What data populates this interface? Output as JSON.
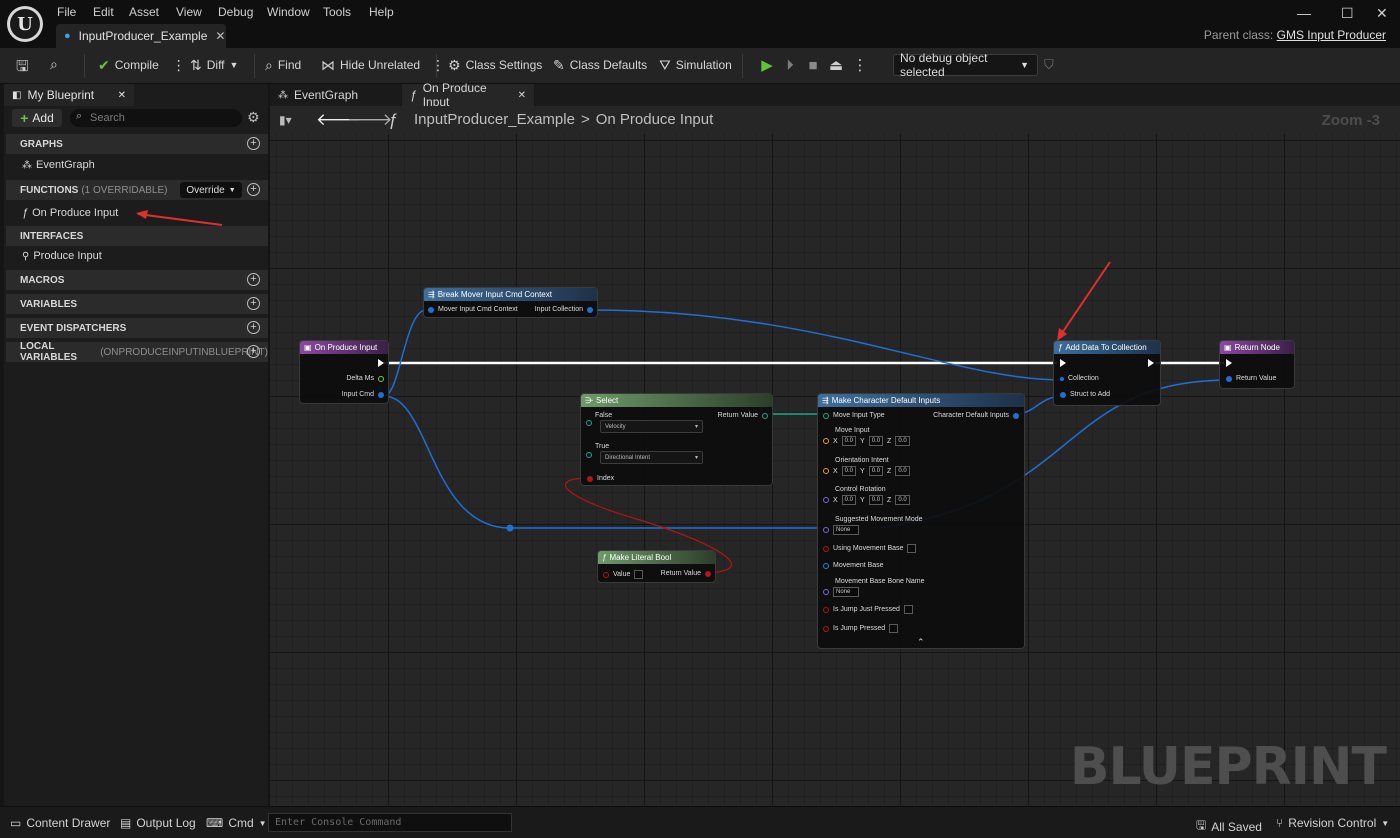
{
  "menu": [
    "File",
    "Edit",
    "Asset",
    "View",
    "Debug",
    "Window",
    "Tools",
    "Help"
  ],
  "document_tab": "InputProducer_Example",
  "parent_class": {
    "label": "Parent class:",
    "value": "GMS Input Producer"
  },
  "toolbar": {
    "compile": "Compile",
    "diff": "Diff",
    "find": "Find",
    "hide_unrelated": "Hide Unrelated",
    "class_settings": "Class Settings",
    "class_defaults": "Class Defaults",
    "simulation": "Simulation",
    "debug_object": "No debug object selected"
  },
  "left_panel": {
    "tab": "My Blueprint",
    "add": "Add",
    "search_placeholder": "Search",
    "sections": {
      "graphs": "GRAPHS",
      "functions": "FUNCTIONS",
      "functions_sub": "(1 OVERRIDABLE)",
      "override": "Override",
      "interfaces": "INTERFACES",
      "macros": "MACROS",
      "variables": "VARIABLES",
      "event_dispatchers": "EVENT DISPATCHERS",
      "local_variables": "LOCAL VARIABLES",
      "local_variables_sub": "(ONPRODUCEINPUTINBLUEPRINT)"
    },
    "items": {
      "event_graph": "EventGraph",
      "on_produce_input": "On Produce Input",
      "produce_input": "Produce Input"
    }
  },
  "graph_tabs": [
    "EventGraph",
    "On Produce Input"
  ],
  "breadcrumb": {
    "root": "InputProducer_Example",
    "sep": ">",
    "current": "On Produce Input"
  },
  "zoom": "Zoom -3",
  "watermark": "BLUEPRINT",
  "nodes": {
    "on_produce_input": {
      "title": "On Produce Input",
      "pins": [
        "Delta Ms",
        "Input Cmd"
      ]
    },
    "break_context": {
      "title": "Break Mover Input Cmd Context",
      "pins": [
        "Mover Input Cmd Context",
        "Input Collection"
      ]
    },
    "select": {
      "title": "Select",
      "false_label": "False",
      "false_value": "Velocity",
      "true_label": "True",
      "true_value": "Directional Intent",
      "index": "Index",
      "return": "Return Value"
    },
    "make_literal_bool": {
      "title": "Make Literal Bool",
      "value": "Value",
      "return": "Return Value"
    },
    "make_defaults": {
      "title": "Make Character Default Inputs",
      "out": "Character Default Inputs",
      "move_input_type": "Move Input Type",
      "move_input": "Move Input",
      "orientation_intent": "Orientation Intent",
      "control_rotation": "Control Rotation",
      "suggested_mode": "Suggested Movement Mode",
      "none": "None",
      "using_base": "Using Movement Base",
      "movement_base": "Movement Base",
      "base_bone": "Movement Base Bone Name",
      "jump_just": "Is Jump Just Pressed",
      "jump": "Is Jump Pressed",
      "x": "X",
      "y": "Y",
      "z": "Z",
      "zero": "0.0"
    },
    "add_data": {
      "title": "Add Data To Collection",
      "collection": "Collection",
      "struct": "Struct to Add"
    },
    "return_node": {
      "title": "Return Node",
      "return": "Return Value"
    }
  },
  "statusbar": {
    "content_drawer": "Content Drawer",
    "output_log": "Output Log",
    "cmd": "Cmd",
    "console_placeholder": "Enter Console Command",
    "all_saved": "All Saved",
    "revision_control": "Revision Control"
  }
}
